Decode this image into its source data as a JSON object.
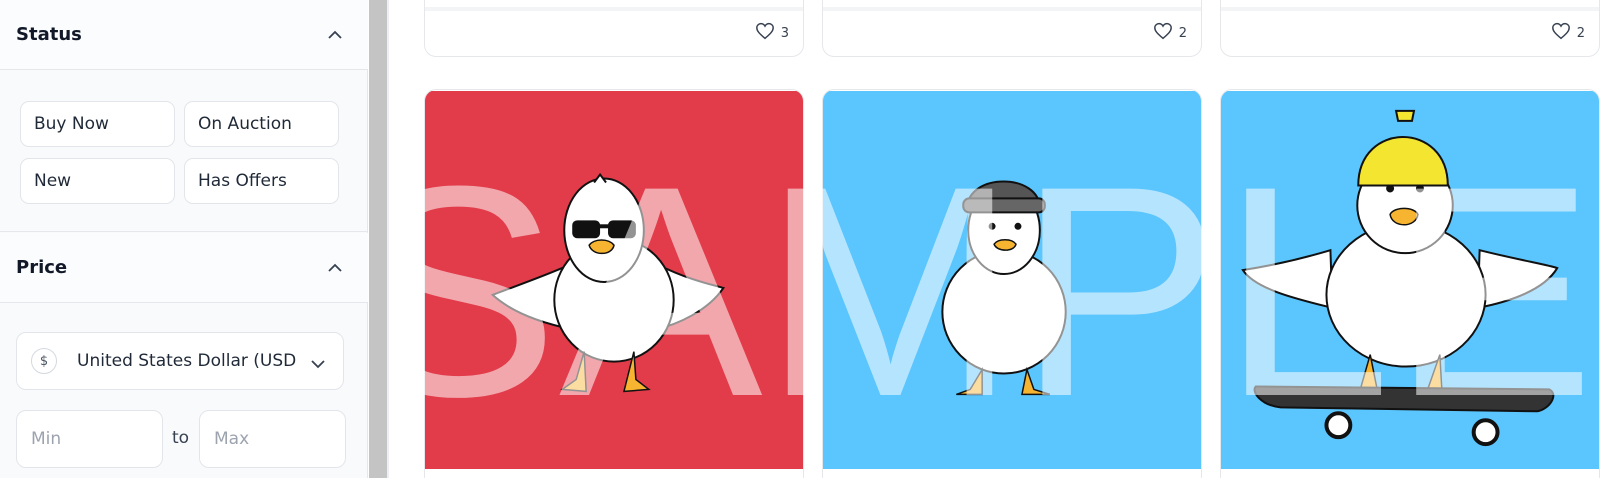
{
  "sidebar": {
    "status": {
      "title": "Status",
      "chips": [
        "Buy Now",
        "On Auction",
        "New",
        "Has Offers"
      ]
    },
    "price": {
      "title": "Price",
      "currency_symbol": "$",
      "currency_value": "United States Dollar (USD)",
      "min_placeholder": "Min",
      "to_label": "to",
      "max_placeholder": "Max"
    }
  },
  "grid": {
    "top_cards": [
      {
        "likes": "3"
      },
      {
        "likes": "2"
      },
      {
        "likes": "2"
      }
    ],
    "image_cards": [
      {
        "bg": "#e23c4a",
        "subject": "duck-with-sunglasses"
      },
      {
        "bg": "#5bc5fd",
        "subject": "duck-with-beanie"
      },
      {
        "bg": "#5bc5fd",
        "subject": "duck-on-skateboard-with-cap"
      }
    ]
  },
  "watermark": "SAMPLE",
  "colors": {
    "card_red": "#e23c4a",
    "card_blue": "#5bc5fd",
    "border": "#e5e7eb",
    "scrollbar": "#c4c4c4"
  }
}
